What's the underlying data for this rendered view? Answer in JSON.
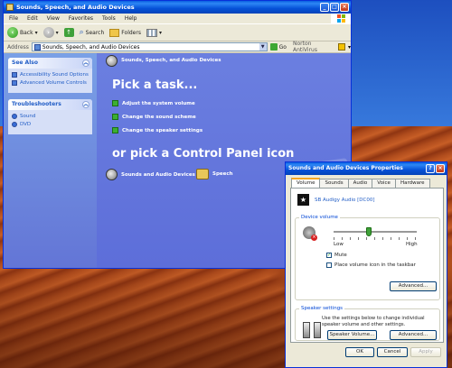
{
  "window": {
    "title": "Sounds, Speech, and Audio Devices",
    "menu": [
      "File",
      "Edit",
      "View",
      "Favorites",
      "Tools",
      "Help"
    ],
    "toolbar": {
      "back": "Back",
      "search": "Search",
      "folders": "Folders"
    },
    "address": {
      "label": "Address",
      "value": "Sounds, Speech, and Audio Devices",
      "go": "Go",
      "norton": "Norton AntiVirus"
    }
  },
  "left_pane": {
    "see_also": {
      "title": "See Also",
      "items": [
        "Accessibility Sound Options",
        "Advanced Volume Controls"
      ]
    },
    "troubleshooters": {
      "title": "Troubleshooters",
      "items": [
        "Sound",
        "DVD"
      ]
    }
  },
  "main": {
    "header": "Sounds, Speech, and Audio Devices",
    "pick_task": "Pick a task...",
    "tasks": [
      "Adjust the system volume",
      "Change the sound scheme",
      "Change the speaker settings"
    ],
    "pick_icon": "or pick a Control Panel icon",
    "icons": [
      "Sounds and Audio Devices",
      "Speech"
    ]
  },
  "dialog": {
    "title": "Sounds and Audio Devices Properties",
    "tabs": [
      "Volume",
      "Sounds",
      "Audio",
      "Voice",
      "Hardware"
    ],
    "device": "SB Audigy Audio [DC00]",
    "device_volume": {
      "label": "Device volume",
      "low": "Low",
      "high": "High",
      "level": 0.42,
      "mute_label": "Mute",
      "mute_checked": true,
      "taskbar_label": "Place volume icon in the taskbar",
      "taskbar_checked": false,
      "advanced": "Advanced..."
    },
    "speaker": {
      "label": "Speaker settings",
      "text": "Use the settings below to change individual speaker volume and other settings.",
      "speaker_volume": "Speaker Volume...",
      "advanced": "Advanced..."
    },
    "buttons": {
      "ok": "OK",
      "cancel": "Cancel",
      "apply": "Apply"
    }
  }
}
